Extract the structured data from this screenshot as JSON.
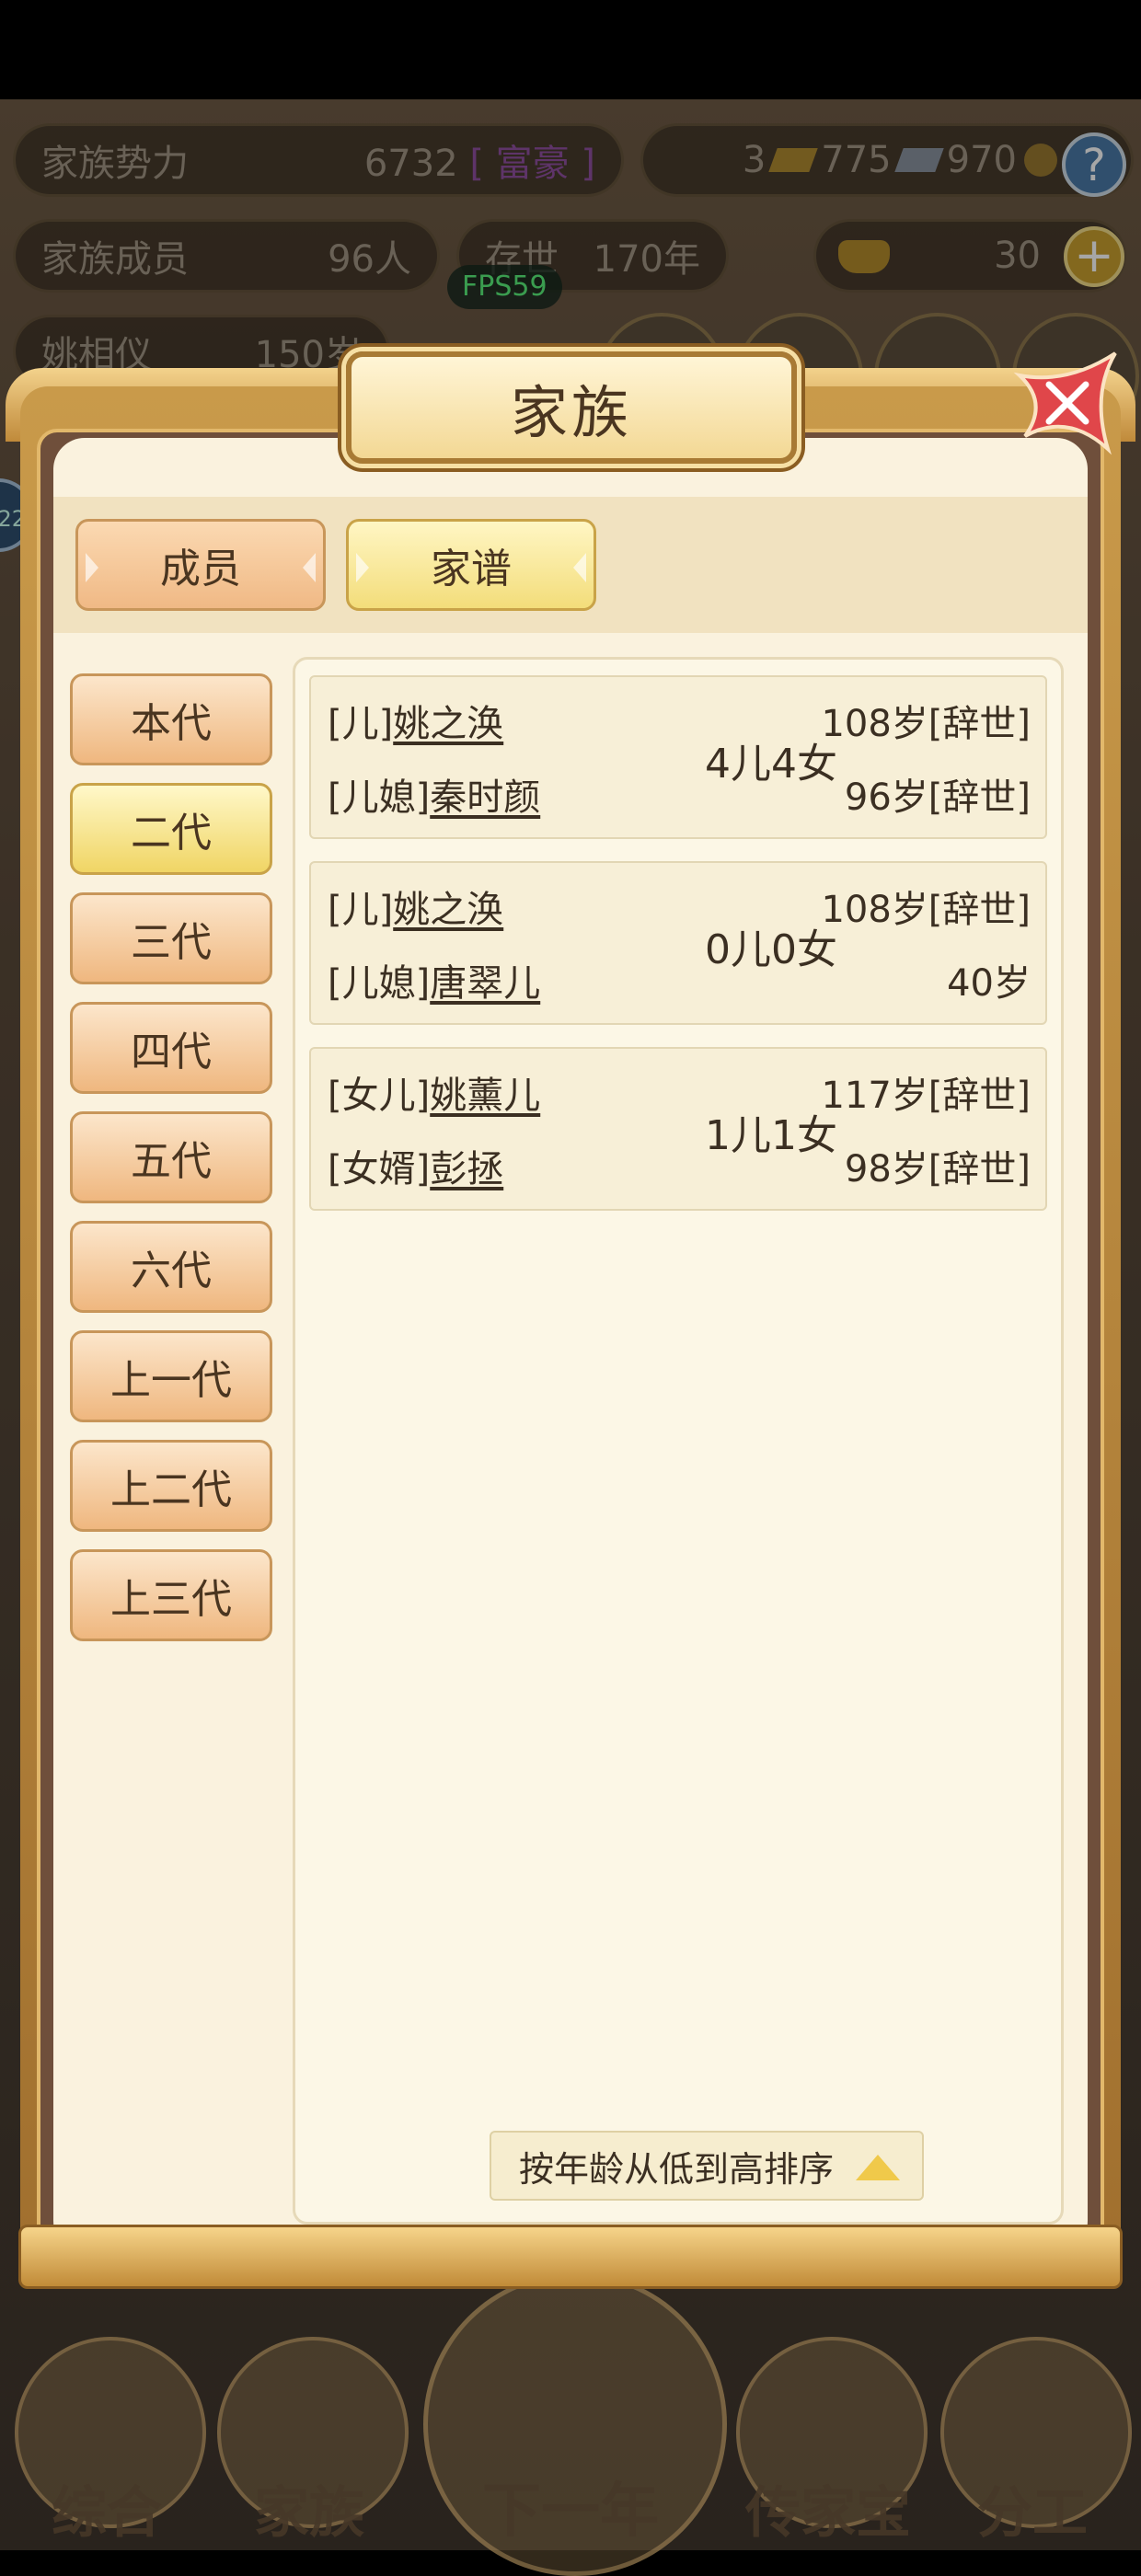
{
  "hud": {
    "power_label": "家族势力",
    "power_value": "6732",
    "power_rank": "[ 富豪 ]",
    "currency_gold": "3",
    "currency_silver": "775",
    "currency_copper": "970",
    "members_label": "家族成员",
    "members_value": "96人",
    "exist_label": "存世",
    "exist_value": "170年",
    "ingot_value": "30",
    "leader_name": "姚相仪",
    "leader_age": "150岁",
    "fps": "FPS59",
    "help_icon": "help-icon",
    "add_icon": "plus-icon",
    "side_badge": "22"
  },
  "modal": {
    "title": "家族",
    "tabs": [
      {
        "label": "成员",
        "active": false
      },
      {
        "label": "家谱",
        "active": true
      }
    ],
    "generations": [
      {
        "label": "本代",
        "active": false
      },
      {
        "label": "二代",
        "active": true
      },
      {
        "label": "三代",
        "active": false
      },
      {
        "label": "四代",
        "active": false
      },
      {
        "label": "五代",
        "active": false
      },
      {
        "label": "六代",
        "active": false
      },
      {
        "label": "上一代",
        "active": false
      },
      {
        "label": "上二代",
        "active": false
      },
      {
        "label": "上三代",
        "active": false
      }
    ],
    "couples": [
      {
        "role1": "[儿]",
        "name1": "姚之涣",
        "age1": "108岁[辞世]",
        "role2": "[儿媳]",
        "name2": "秦时颜",
        "age2": "96岁[辞世]",
        "children": "4儿4女"
      },
      {
        "role1": "[儿]",
        "name1": "姚之涣",
        "age1": "108岁[辞世]",
        "role2": "[儿媳]",
        "name2": "唐翠儿",
        "age2": "40岁",
        "children": "0儿0女"
      },
      {
        "role1": "[女儿]",
        "name1": "姚薰儿",
        "age1": "117岁[辞世]",
        "role2": "[女婿]",
        "name2": "彭拯",
        "age2": "98岁[辞世]",
        "children": "1儿1女"
      }
    ],
    "sort_label": "按年龄从低到高排序"
  },
  "bottom_nav": {
    "items": [
      "综合",
      "家族",
      "下一年",
      "传家宝",
      "分工"
    ]
  },
  "colors": {
    "panel": "#faf2de",
    "tab_active": "#f3dd7a",
    "tab_inactive": "#f0b985",
    "frame": "#c99a4a",
    "text": "#3b2f22",
    "fps": "#59f07a"
  }
}
